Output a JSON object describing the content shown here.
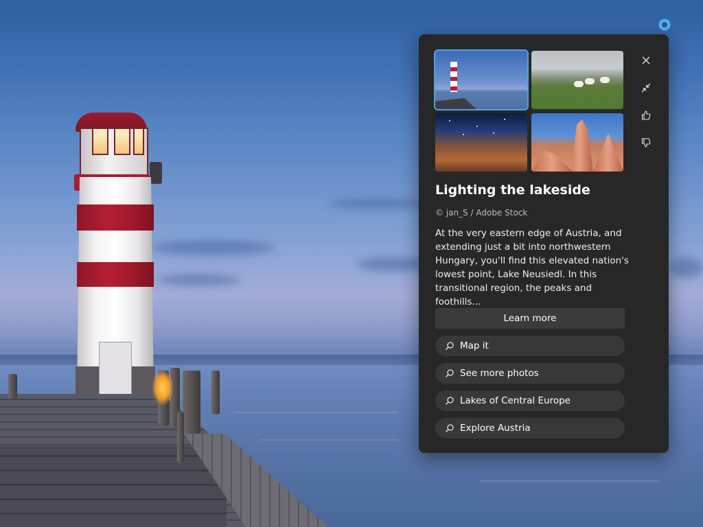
{
  "spotlight": {
    "title": "Lighting the lakeside",
    "credit": "© jan_S / Adobe Stock",
    "description": "At the very eastern edge of Austria, and extending just a bit into northwestern Hungary, you'll find this elevated nation's lowest point, Lake Neusiedl. In this transitional region, the peaks and foothills...",
    "learn_more_label": "Learn more",
    "thumbnails": [
      {
        "name": "lighthouse-thumbnail",
        "selected": true
      },
      {
        "name": "sheep-thumbnail",
        "selected": false
      },
      {
        "name": "nebula-thumbnail",
        "selected": false
      },
      {
        "name": "red-rocks-thumbnail",
        "selected": false
      }
    ],
    "search_links": [
      {
        "label": "Map it",
        "icon": "search-icon"
      },
      {
        "label": "See more photos",
        "icon": "search-icon"
      },
      {
        "label": "Lakes of Central Europe",
        "icon": "search-icon"
      },
      {
        "label": "Explore Austria",
        "icon": "search-icon"
      }
    ],
    "side_actions": [
      "close-icon",
      "collapse-icon",
      "thumbs-up-icon",
      "thumbs-down-icon"
    ]
  },
  "colors": {
    "panel_bg": "#272727",
    "selected_outline": "#4aa3e8",
    "button_bg": "#3b3b3b"
  }
}
